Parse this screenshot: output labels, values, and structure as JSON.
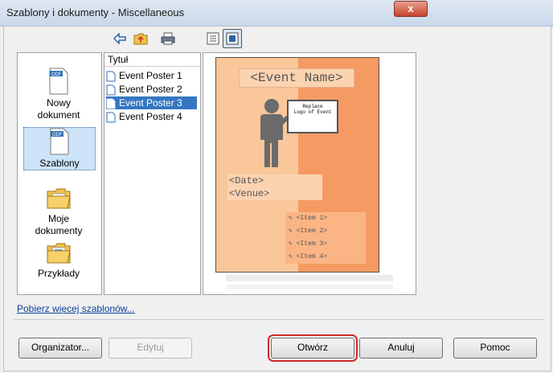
{
  "window": {
    "title": "Szablony i dokumenty - Miscellaneous",
    "close_label": "x"
  },
  "toolbar": {
    "icons": [
      "back-icon",
      "folder-up-icon",
      "print-icon",
      "details-view-icon",
      "preview-view-icon"
    ]
  },
  "categories": [
    {
      "label_line1": "Nowy",
      "label_line2": "dokument",
      "icon": "new-document-icon"
    },
    {
      "label_line1": "Szablony",
      "label_line2": "",
      "icon": "templates-icon"
    },
    {
      "label_line1": "Moje",
      "label_line2": "dokumenty",
      "icon": "my-documents-icon"
    },
    {
      "label_line1": "Przykłady",
      "label_line2": "",
      "icon": "examples-icon"
    }
  ],
  "list": {
    "header": "Tytuł",
    "items": [
      "Event Poster 1",
      "Event Poster 2",
      "Event Poster 3",
      "Event Poster 4"
    ],
    "selected": "Event Poster 3"
  },
  "preview": {
    "event_name": "<Event Name>",
    "logo_text_line1": "Replace",
    "logo_text_line2": "Logo of Event",
    "date": "<Date>",
    "venue": "<Venue>",
    "items": [
      "<Item 1>",
      "<Item 2>",
      "<Item 3>",
      "<Item 4>"
    ],
    "colors": {
      "left": "#f9c79a",
      "right": "#f59a63"
    }
  },
  "link_more": "Pobierz więcej szablonów...",
  "buttons": {
    "organizer": "Organizator...",
    "edit": "Edytuj",
    "open": "Otwórz",
    "cancel": "Anuluj",
    "help": "Pomoc"
  }
}
